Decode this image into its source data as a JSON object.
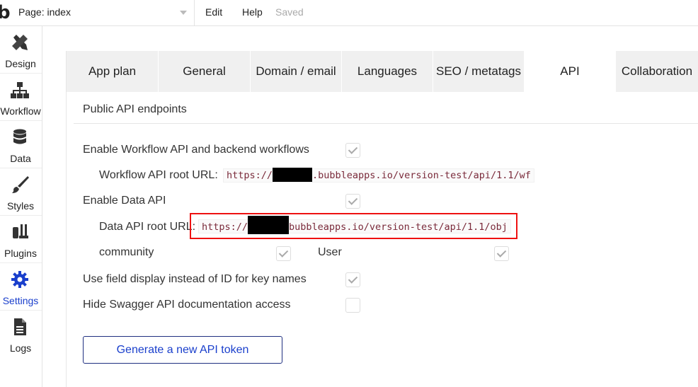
{
  "topbar": {
    "logo": "b",
    "page_select": "Page: index",
    "menu_edit": "Edit",
    "menu_help": "Help",
    "status": "Saved"
  },
  "sidebar": {
    "items": [
      {
        "label": "Design",
        "icon": "design-icon"
      },
      {
        "label": "Workflow",
        "icon": "workflow-icon"
      },
      {
        "label": "Data",
        "icon": "database-icon"
      },
      {
        "label": "Styles",
        "icon": "brush-icon"
      },
      {
        "label": "Plugins",
        "icon": "plug-icon"
      },
      {
        "label": "Settings",
        "icon": "gear-icon",
        "active": true
      },
      {
        "label": "Logs",
        "icon": "document-icon"
      }
    ],
    "active_color": "#1a3fcc"
  },
  "tabs": [
    "App plan",
    "General",
    "Domain / email",
    "Languages",
    "SEO / metatags",
    "API",
    "Collaboration"
  ],
  "active_tab": "API",
  "api": {
    "section_title": "Public API endpoints",
    "enable_workflow_label": "Enable Workflow API and backend workflows",
    "enable_workflow_checked": true,
    "workflow_root_label": "Workflow API root URL:",
    "workflow_url_prefix": "https://",
    "workflow_url_suffix": ".bubbleapps.io/version-test/api/1.1/wf",
    "enable_data_label": "Enable Data API",
    "enable_data_checked": true,
    "data_root_label": "Data API root URL:",
    "data_url_prefix": "https://",
    "data_url_suffix": "bubbleapps.io/version-test/api/1.1/obj",
    "type_community_label": "community",
    "type_community_checked": true,
    "type_user_label": "User",
    "type_user_checked": true,
    "field_display_label": "Use field display instead of ID for key names",
    "field_display_checked": true,
    "hide_swagger_label": "Hide Swagger API documentation access",
    "hide_swagger_checked": false,
    "generate_token_button": "Generate a new API token"
  }
}
